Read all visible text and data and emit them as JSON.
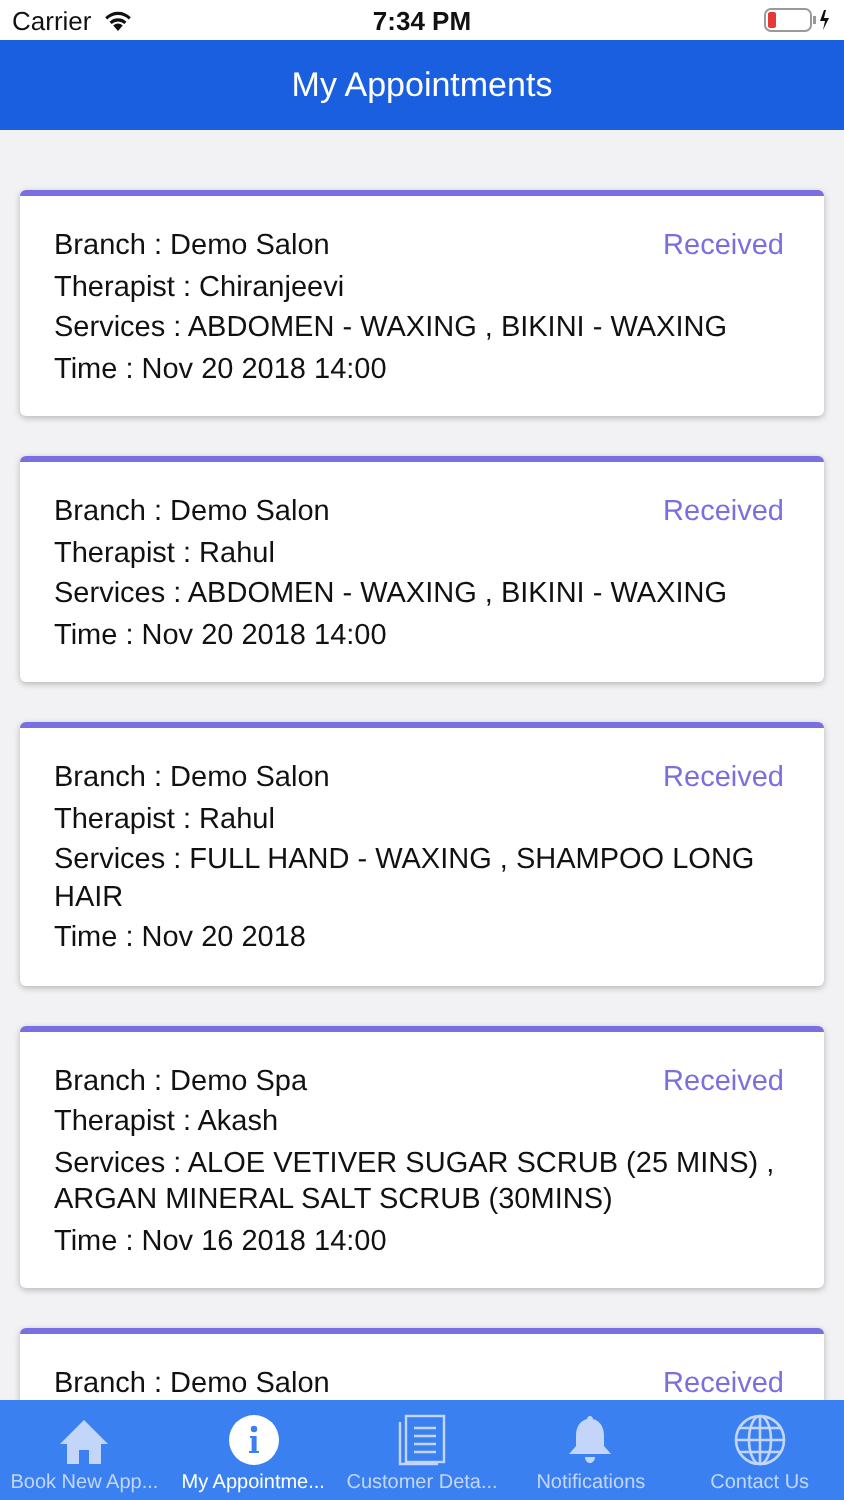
{
  "status_bar": {
    "carrier": "Carrier",
    "time": "7:34 PM"
  },
  "header": {
    "title": "My Appointments"
  },
  "appointments": [
    {
      "branch": "Branch : Demo Salon",
      "status": "Received",
      "therapist": "Therapist : Chiranjeevi",
      "services": "Services : ABDOMEN - WAXING , BIKINI - WAXING",
      "time": "Time : Nov 20 2018 14:00"
    },
    {
      "branch": "Branch : Demo Salon",
      "status": "Received",
      "therapist": "Therapist : Rahul",
      "services": "Services : ABDOMEN - WAXING , BIKINI - WAXING",
      "time": "Time : Nov 20 2018 14:00"
    },
    {
      "branch": "Branch : Demo Salon",
      "status": "Received",
      "therapist": "Therapist : Rahul",
      "services": "Services : FULL HAND - WAXING , SHAMPOO LONG HAIR",
      "time": "Time : Nov 20 2018"
    },
    {
      "branch": "Branch : Demo Spa",
      "status": "Received",
      "therapist": "Therapist : Akash",
      "services": "Services : ALOE VETIVER SUGAR SCRUB (25 MINS) , ARGAN MINERAL SALT SCRUB (30MINS)",
      "time": "Time : Nov 16 2018 14:00"
    },
    {
      "branch": "Branch : Demo Salon",
      "status": "Received"
    }
  ],
  "tab_bar": [
    {
      "kind": "home",
      "label": "Book New App...",
      "selected": false
    },
    {
      "kind": "info",
      "label": "My Appointme...",
      "selected": true
    },
    {
      "kind": "document",
      "label": "Customer Deta...",
      "selected": false
    },
    {
      "kind": "bell",
      "label": "Notifications",
      "selected": false
    },
    {
      "kind": "globe",
      "label": "Contact Us",
      "selected": false
    }
  ]
}
